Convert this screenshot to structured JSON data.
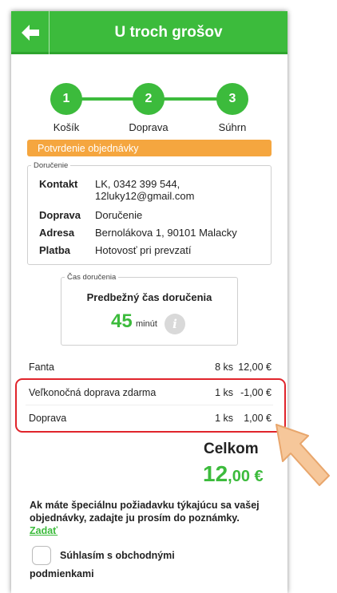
{
  "header": {
    "title": "U troch grošov",
    "back_icon": "arrow-left-icon"
  },
  "steps": [
    {
      "number": "1",
      "label": "Košík"
    },
    {
      "number": "2",
      "label": "Doprava"
    },
    {
      "number": "3",
      "label": "Súhrn"
    }
  ],
  "section_title": "Potvrdenie objednávky",
  "delivery_box": {
    "legend": "Doručenie",
    "rows": [
      {
        "key": "Kontakt",
        "value_line1": "LK, 0342 399 544,",
        "value_line2": "12luky12@gmail.com"
      },
      {
        "key": "Doprava",
        "value": "Doručenie"
      },
      {
        "key": "Adresa",
        "value": "Bernolákova 1, 90101 Malacky"
      },
      {
        "key": "Platba",
        "value": "Hotovosť pri prevzatí"
      }
    ]
  },
  "time_box": {
    "legend": "Čas doručenia",
    "title": "Predbežný čas doručenia",
    "minutes": "45",
    "unit": "minút",
    "info_icon": "i"
  },
  "items": [
    {
      "name": "Fanta",
      "qty": "8 ks",
      "price": "12,00 €"
    },
    {
      "name": "Veľkonočná doprava zdarma",
      "qty": "1 ks",
      "price": "-1,00 €"
    },
    {
      "name": "Doprava",
      "qty": "1 ks",
      "price": "1,00 €"
    }
  ],
  "total": {
    "label": "Celkom",
    "int": "12",
    "dec": ",00 €"
  },
  "note": {
    "text": "Ak máte špeciálnu požiadavku týkajúcu sa vašej objednávky, zadajte ju prosím do poznámky. ",
    "link": "Zadať"
  },
  "terms": {
    "line1": "Súhlasím s obchodnými",
    "line2": "podmienkami"
  },
  "colors": {
    "green": "#3cbb3c",
    "orange": "#f5a63f",
    "highlight": "#e0242b",
    "arrow": "#f6c79a"
  }
}
